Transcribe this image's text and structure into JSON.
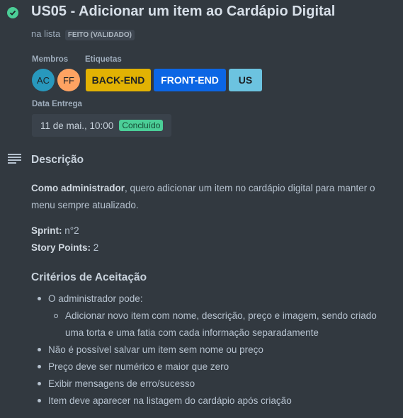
{
  "card": {
    "title": "US05 - Adicionar um item ao Cardápio Digital",
    "list_prefix": "na lista",
    "list_name": "FEITO (VALIDADO)"
  },
  "members": {
    "label": "Membros",
    "items": [
      {
        "initials": "AC",
        "color": "#2898bd"
      },
      {
        "initials": "FF",
        "color": "#fea362"
      }
    ]
  },
  "labels": {
    "label": "Etiquetas",
    "items": [
      {
        "text": "BACK-END",
        "color": "#e2b203"
      },
      {
        "text": "FRONT-END",
        "color": "#0c66e4"
      },
      {
        "text": "US",
        "color": "#6cc3e0"
      }
    ]
  },
  "due": {
    "label": "Data Entrega",
    "value": "11 de mai., 10:00",
    "status": "Concluído"
  },
  "description": {
    "title": "Descrição",
    "intro_bold": "Como administrador",
    "intro_rest": ", quero adicionar um item no cardápio digital para manter o",
    "intro_line2": "menu sempre atualizado.",
    "sprint_label": "Sprint:",
    "sprint_value": " n°2",
    "points_label": "Story Points:",
    "points_value": " 2",
    "criteria_title": "Critérios de Aceitação",
    "criteria": [
      "O administrador pode:",
      "Adicionar novo item com nome, descrição, preço e imagem, sendo criado",
      "uma torta e uma fatia com cada informação separadamente",
      "Não é possível salvar um item sem nome ou preço",
      "Preço deve ser numérico e maior que zero",
      "Exibir mensagens de erro/sucesso",
      "Item deve aparecer na listagem do cardápio após criação"
    ]
  }
}
